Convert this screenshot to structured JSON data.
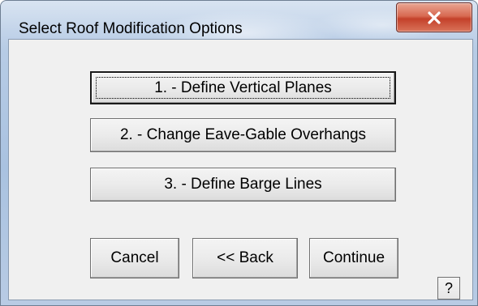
{
  "window": {
    "title": "Select Roof Modification Options",
    "close_icon": "close-icon",
    "close_color": "#c4412a"
  },
  "options": [
    {
      "label": "1. - Define Vertical Planes"
    },
    {
      "label": "2. - Change Eave-Gable Overhangs"
    },
    {
      "label": "3. - Define Barge Lines"
    }
  ],
  "footer": {
    "cancel_label": "Cancel",
    "back_label": "<< Back",
    "continue_label": "Continue",
    "help_label": "?"
  }
}
